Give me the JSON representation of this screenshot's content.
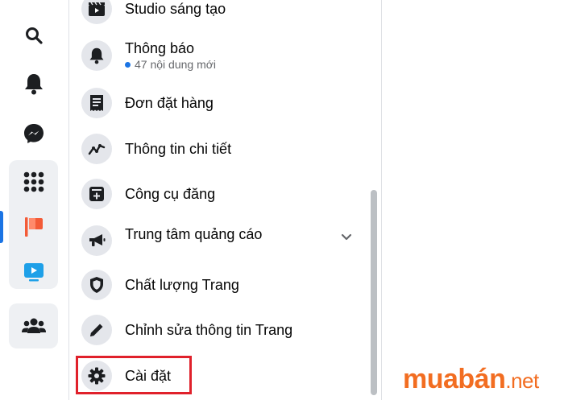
{
  "rail": {
    "icons": [
      "search-icon",
      "bell-icon",
      "messenger-icon",
      "grid-icon",
      "flag-icon",
      "video-icon",
      "people-icon"
    ],
    "colors": {
      "accent": "#1b74e4",
      "flag": "#f35b37",
      "video": "#1ea0e8",
      "messenger": "#1c1e21"
    }
  },
  "menu": {
    "items": [
      {
        "label": "Studio sáng tạo",
        "icon": "clapperboard-icon"
      },
      {
        "label": "Thông báo",
        "sub": "47 nội dung mới",
        "icon": "bell-icon"
      },
      {
        "label": "Đơn đặt hàng",
        "icon": "receipt-icon"
      },
      {
        "label": "Thông tin chi tiết",
        "icon": "trend-line-icon"
      },
      {
        "label": "Công cụ đăng",
        "icon": "post-tools-icon"
      },
      {
        "label": "Trung tâm quảng cáo",
        "icon": "megaphone-icon",
        "expandable": true
      },
      {
        "label": "Chất lượng Trang",
        "icon": "shield-icon"
      },
      {
        "label": "Chỉnh sửa thông tin Trang",
        "icon": "pencil-icon"
      },
      {
        "label": "Cài đặt",
        "icon": "gear-icon",
        "highlighted": true
      }
    ],
    "colors": {
      "highlight_border": "#e0212b",
      "unread_dot": "#1b74e4"
    }
  },
  "watermark": {
    "brand": "muabán",
    "tld": ".net",
    "color": "#f26d21"
  }
}
